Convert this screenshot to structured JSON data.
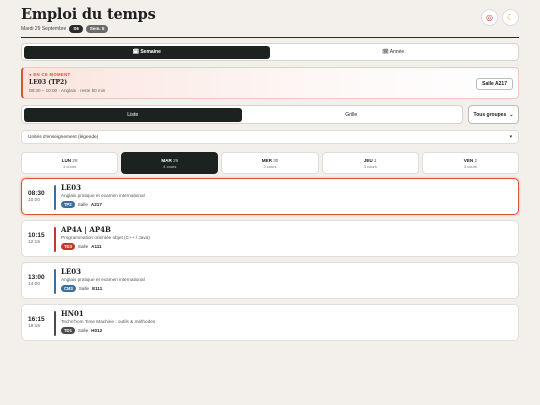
{
  "header": {
    "title": "Emploi du temps",
    "date": "Mardi 29 Septembre",
    "week_badge": "S6",
    "sem_badge": "Sem. 5"
  },
  "view_toggle": {
    "week": "🗓 Semaine",
    "year": "🗓 Année"
  },
  "now": {
    "label": "● EN CE MOMENT",
    "code": "LE03 (TP2)",
    "meta": "08:30 – 10:00 · Anglais · reste 50 min",
    "room": "Salle A217"
  },
  "display": {
    "list": "Liste",
    "grid": "Grille",
    "group_select": "Tous groupes"
  },
  "legend": {
    "label": "Unités d'enseignement (légende)",
    "arrow": "▾"
  },
  "days": [
    {
      "name": "LUN",
      "num": "28",
      "count": "3 cours"
    },
    {
      "name": "MAR",
      "num": "29",
      "count": "4 cours"
    },
    {
      "name": "MER",
      "num": "30",
      "count": "3 cours"
    },
    {
      "name": "JEU",
      "num": "1",
      "count": "3 cours"
    },
    {
      "name": "VEN",
      "num": "2",
      "count": "3 cours"
    }
  ],
  "courses": [
    {
      "start": "08:30",
      "end": "10:00",
      "code": "LE03",
      "desc": "Anglais pratique et examen international",
      "tag": "TP2",
      "room_label": "Salle",
      "room": "A217",
      "color": "#3c6fa0"
    },
    {
      "start": "10:15",
      "end": "12:15",
      "code": "AP4A | AP4B",
      "desc": "Programmation orientée objet (C++ / Java)",
      "tag": "TD3",
      "room_label": "Salle",
      "room": "A111",
      "color": "#c0392b"
    },
    {
      "start": "13:00",
      "end": "14:00",
      "code": "LE03",
      "desc": "Anglais pratique et examen international",
      "tag": "CM3",
      "room_label": "Salle",
      "room": "E111",
      "color": "#3c6fa0"
    },
    {
      "start": "16:15",
      "end": "19:15",
      "code": "HN01",
      "desc": "Techn'hom Time Machine : outils & méthodes",
      "tag": "TD1",
      "room_label": "Salle",
      "room": "H012",
      "color": "#4a4a4a"
    }
  ]
}
